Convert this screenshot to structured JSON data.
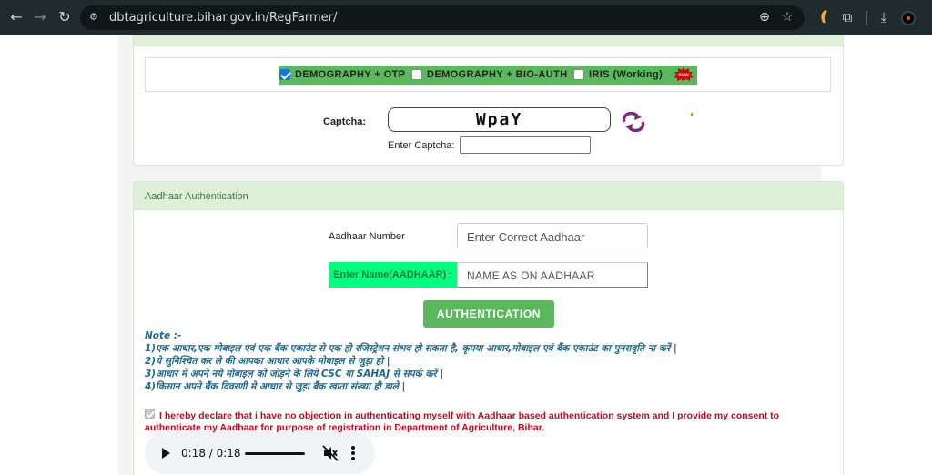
{
  "browser": {
    "url": "dbtagriculture.bihar.gov.in/RegFarmer/",
    "back_icon": "←",
    "forward_icon": "→",
    "reload_icon": "↻",
    "site_info_icon": "⚙",
    "zoom_icon": "⊕",
    "star_icon": "☆",
    "extensions_icon": "⧉",
    "download_icon": "⤓"
  },
  "auth_options": {
    "options": [
      {
        "label": "DEMOGRAPHY + OTP",
        "checked": true
      },
      {
        "label": "DEMOGRAPHY + BIO-AUTH",
        "checked": false
      },
      {
        "label": "IRIS (Working)",
        "checked": false
      }
    ],
    "new_badge": "new"
  },
  "captcha": {
    "label": "Captcha:",
    "text": "WpaY",
    "enter_label": "Enter Captcha:",
    "value": ""
  },
  "aadhaar_panel": {
    "title": "Aadhaar Authentication",
    "aadhaar_label": "Aadhaar Number",
    "aadhaar_placeholder": "Enter Correct Aadhaar",
    "name_label": "Enter Name(AADHAAR) :",
    "name_placeholder": "NAME AS ON AADHAAR",
    "auth_button": "AUTHENTICATION"
  },
  "note": {
    "heading": "Note :-",
    "lines": [
      "1)एक आधार,एक मोबाइल एवं एक बैंक एकाउंट से एक ही रजिस्ट्रेशन संभव हो सकता है, कृपया आधार,मोबाइल एवं बैंक एकाउंट का पुनरावृति ना करें |",
      "2)ये सुनिश्चित कर ले की आपका आधार आपके मोबाइल से जुड़ा हो |",
      "3)आधार में अपने नये मोबाइल को जोड़ने के लिये CSC या SAHAJ से संपर्क करें |",
      "4)किसान अपने बैंक विवरणी मे आधार से जुड़ा बैंक खाता संख्या ही डाले |"
    ]
  },
  "declaration": {
    "checked": true,
    "text": "I hereby declare that i have no objection in authenticating myself with Aadhaar based authentication system and I provide my consent to authenticate my Aadhaar for purpose of registration in Department of Agriculture, Bihar."
  },
  "audio": {
    "time": "0:18 / 0:18",
    "progress": 1.0
  }
}
